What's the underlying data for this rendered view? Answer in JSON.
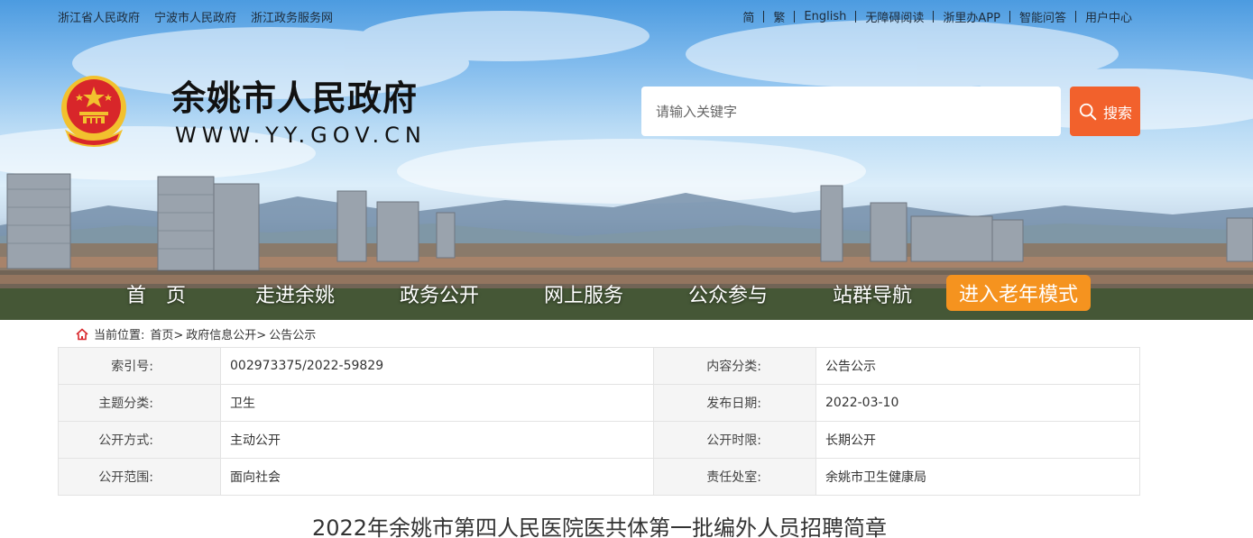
{
  "top_left_links": [
    "浙江省人民政府",
    "宁波市人民政府",
    "浙江政务服务网"
  ],
  "top_right_links": [
    "简",
    "繁",
    "English",
    "无障碍阅读",
    "浙里办APP",
    "智能问答",
    "用户中心"
  ],
  "site": {
    "title": "余姚市人民政府",
    "url": "WWW.YY.GOV.CN"
  },
  "search": {
    "placeholder": "请输入关键字",
    "button_label": "搜索"
  },
  "nav": {
    "items": [
      "首　页",
      "走进余姚",
      "政务公开",
      "网上服务",
      "公众参与",
      "站群导航"
    ],
    "elder_mode": "进入老年模式"
  },
  "breadcrumb": {
    "prefix": "当前位置:",
    "crumbs": [
      "首页>",
      "政府信息公开>",
      "公告公示"
    ]
  },
  "info": {
    "rows": [
      {
        "label1": "索引号:",
        "value1": "002973375/2022-59829",
        "label2": "内容分类:",
        "value2": "公告公示"
      },
      {
        "label1": "主题分类:",
        "value1": "卫生",
        "label2": "发布日期:",
        "value2": "2022-03-10"
      },
      {
        "label1": "公开方式:",
        "value1": "主动公开",
        "label2": "公开时限:",
        "value2": "长期公开"
      },
      {
        "label1": "公开范围:",
        "value1": "面向社会",
        "label2": "责任处室:",
        "value2": "余姚市卫生健康局"
      }
    ]
  },
  "article": {
    "title": "2022年余姚市第四人民医院医共体第一批编外人员招聘简章"
  },
  "colors": {
    "search_button": "#f2612c",
    "elder_button": "#f5931f",
    "emblem_red": "#d8262a",
    "emblem_gold": "#f2c12e"
  }
}
